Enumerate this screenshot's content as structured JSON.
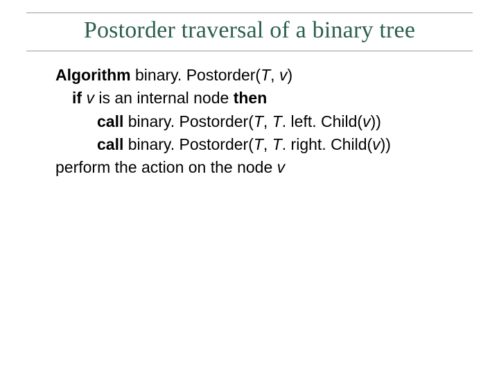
{
  "title": "Postorder traversal of a binary tree",
  "alg": {
    "kw_algorithm": "Algorithm",
    "fn1": " binary. Postorder(",
    "args1a": "T",
    "comma": ", ",
    "args1b": "v",
    "close1": ")",
    "kw_if": "if ",
    "v": "v",
    "mid_if": " is an internal node ",
    "kw_then": "then",
    "kw_call1": "call",
    "call1a": " binary. Postorder(",
    "T1": "T",
    "sep1": ", ",
    "T1b": "T",
    "call1b": ". left. Child(",
    "v1": "v",
    "call1c": "))",
    "kw_call2": "call",
    "call2a": " binary. Postorder(",
    "T2": "T",
    "sep2": ", ",
    "T2b": "T",
    "call2b": ". right. Child(",
    "v2": "v",
    "call2c": "))",
    "last_a": "perform the action on the node ",
    "last_v": "v"
  }
}
